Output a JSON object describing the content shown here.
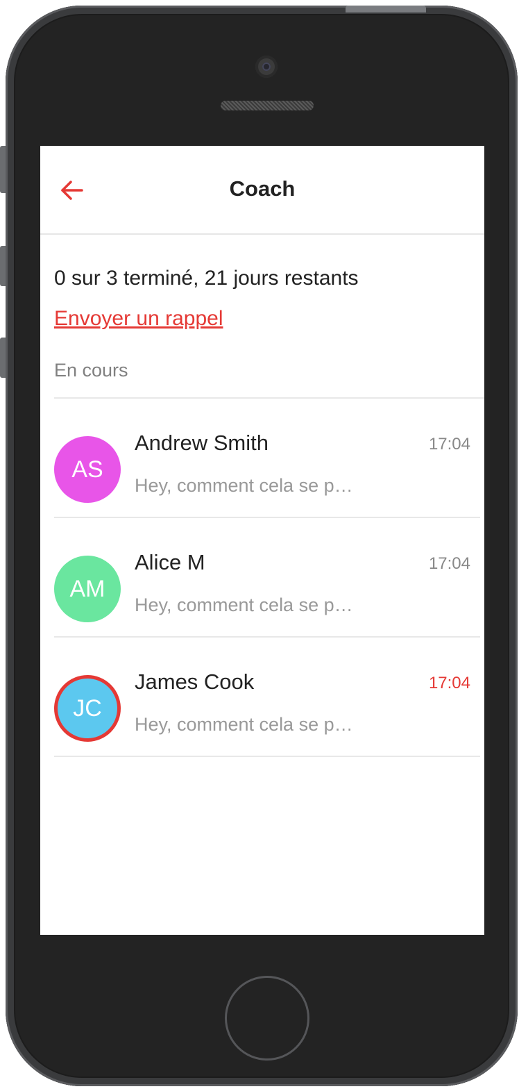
{
  "header": {
    "title": "Coach",
    "back_icon": "arrow-left-icon",
    "accent_color": "#e53935"
  },
  "progress_text": "0 sur 3 terminé, 21 jours restants",
  "reminder_link": "Envoyer un rappel",
  "section_label": "En cours",
  "conversations": [
    {
      "initials": "AS",
      "name": "Andrew Smith",
      "time": "17:04",
      "preview": "Hey, comment cela se passe ?",
      "avatar_color": "#e855e8",
      "highlighted": false
    },
    {
      "initials": "AM",
      "name": "Alice M",
      "time": "17:04",
      "preview": "Hey, comment cela se passe ?",
      "avatar_color": "#6ae69f",
      "highlighted": false
    },
    {
      "initials": "JC",
      "name": "James Cook",
      "time": "17:04",
      "preview": "Hey, comment cela se passe ?",
      "avatar_color": "#5cc8ef",
      "highlighted": true
    }
  ]
}
